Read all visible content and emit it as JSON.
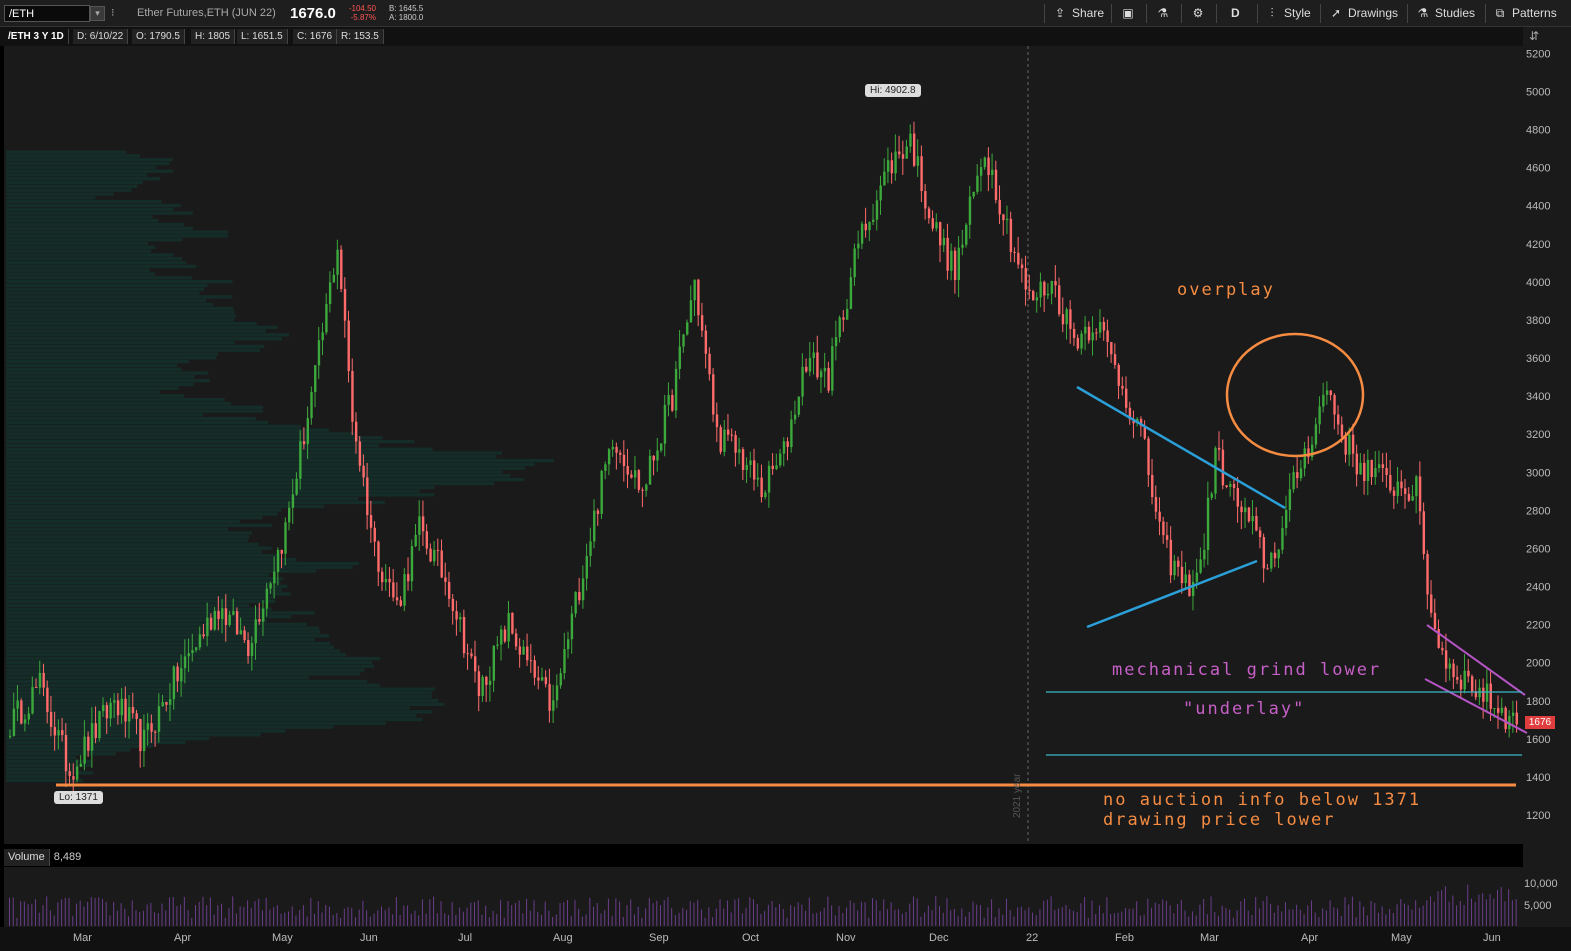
{
  "toolbar": {
    "symbol_input": "/ETH",
    "description": "Ether Futures,ETH (JUN 22)",
    "last_price": "1676.0",
    "change": "-104.50",
    "change_pct": "-5.87%",
    "bid": "B: 1645.5",
    "ask": "A: 1800.0",
    "share": "Share",
    "aggregation": "D",
    "style": "Style",
    "drawings": "Drawings",
    "studies": "Studies",
    "patterns": "Patterns"
  },
  "infobar": {
    "title": "/ETH 3 Y 1D",
    "date": "D: 6/10/22",
    "open": "O: 1790.5",
    "high": "H: 1805",
    "low": "L: 1651.5",
    "close": "C: 1676",
    "range": "R: 153.5"
  },
  "volume": {
    "label": "Volume",
    "value": "8,489"
  },
  "annotations": {
    "overplay": "overplay",
    "mechanical": "mechanical grind lower",
    "underlay": "\"underlay\"",
    "no_auction": "no auction info below 1371",
    "drawing_lower": "drawing price lower"
  },
  "markers": {
    "high_bubble": "Hi: 4902.8",
    "low_bubble": "Lo: 1371",
    "price_tag": "1676",
    "year_label": "2021 year"
  },
  "colors": {
    "up": "#3ca93c",
    "down": "#ff6b6b",
    "profile": "#15302b",
    "orange": "#f58c42",
    "blue": "#2a9fd8",
    "purple": "#b454c4",
    "cyan": "#3bb8c8"
  },
  "chart_data": {
    "type": "candlestick",
    "symbol": "/ETH",
    "aggregation": "1D",
    "ylim": [
      1100,
      5300
    ],
    "y_ticks": [
      1200,
      1400,
      1600,
      1800,
      2000,
      2200,
      2400,
      2600,
      2800,
      3000,
      3200,
      3400,
      3600,
      3800,
      4000,
      4200,
      4400,
      4600,
      4800,
      5000,
      5200
    ],
    "x_ticks": [
      "Mar",
      "Apr",
      "May",
      "Jun",
      "Jul",
      "Aug",
      "Sep",
      "Oct",
      "Nov",
      "Dec",
      "22",
      "Feb",
      "Mar",
      "Apr",
      "May",
      "Jun"
    ],
    "volume_ticks": [
      "10,000",
      "5,000"
    ],
    "high": 4902.8,
    "low": 1371,
    "last": 1676,
    "anchors": [
      [
        0,
        1680
      ],
      [
        8,
        1880
      ],
      [
        16,
        1430
      ],
      [
        28,
        1800
      ],
      [
        36,
        1580
      ],
      [
        44,
        1900
      ],
      [
        56,
        2300
      ],
      [
        64,
        2100
      ],
      [
        74,
        2700
      ],
      [
        82,
        3500
      ],
      [
        88,
        4200
      ],
      [
        92,
        3300
      ],
      [
        98,
        2600
      ],
      [
        104,
        2300
      ],
      [
        110,
        2700
      ],
      [
        118,
        2400
      ],
      [
        126,
        1850
      ],
      [
        134,
        2200
      ],
      [
        140,
        1950
      ],
      [
        146,
        1760
      ],
      [
        154,
        2500
      ],
      [
        162,
        3200
      ],
      [
        170,
        2900
      ],
      [
        178,
        3400
      ],
      [
        184,
        4000
      ],
      [
        190,
        3200
      ],
      [
        196,
        3100
      ],
      [
        202,
        2900
      ],
      [
        208,
        3100
      ],
      [
        214,
        3600
      ],
      [
        220,
        3500
      ],
      [
        228,
        4200
      ],
      [
        236,
        4600
      ],
      [
        242,
        4750
      ],
      [
        248,
        4300
      ],
      [
        254,
        4050
      ],
      [
        262,
        4700
      ],
      [
        268,
        4300
      ],
      [
        274,
        3900
      ],
      [
        280,
        4000
      ],
      [
        286,
        3700
      ],
      [
        292,
        3800
      ],
      [
        298,
        3500
      ],
      [
        304,
        3200
      ],
      [
        310,
        2600
      ],
      [
        316,
        2400
      ],
      [
        320,
        2500
      ],
      [
        324,
        3100
      ],
      [
        328,
        2900
      ],
      [
        334,
        2700
      ],
      [
        338,
        2500
      ],
      [
        342,
        2700
      ],
      [
        346,
        3000
      ],
      [
        350,
        3200
      ],
      [
        354,
        3450
      ],
      [
        358,
        3200
      ],
      [
        362,
        3050
      ],
      [
        370,
        2950
      ],
      [
        378,
        2900
      ],
      [
        382,
        2250
      ],
      [
        386,
        2000
      ],
      [
        392,
        1900
      ],
      [
        398,
        1800
      ],
      [
        405,
        1676
      ]
    ]
  }
}
